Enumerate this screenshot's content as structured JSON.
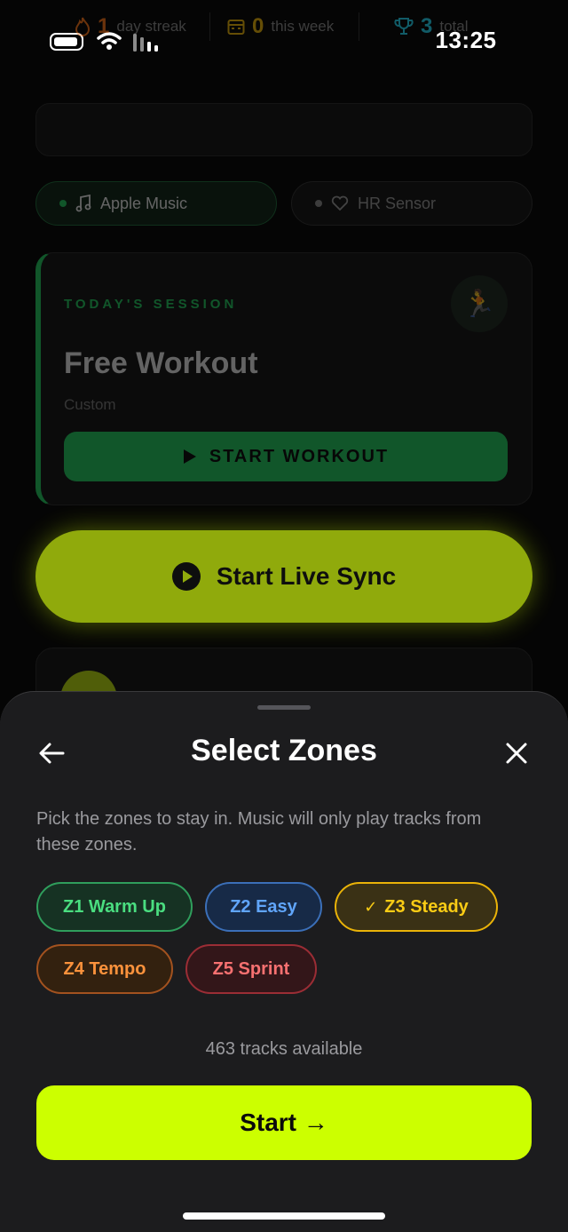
{
  "status_bar": {
    "time": "13:25"
  },
  "stats": {
    "streak": {
      "value": "1",
      "label": "day streak",
      "color": "#f97316"
    },
    "week": {
      "value": "0",
      "label": "this week",
      "color": "#eab308"
    },
    "total": {
      "value": "3",
      "label": "total",
      "color": "#22d3ee"
    }
  },
  "connections": {
    "music": {
      "label": "Apple Music",
      "dot_color": "#22c55e",
      "icon": "music-note-icon"
    },
    "hr": {
      "label": "HR Sensor",
      "dot_color": "#8a8a8a",
      "icon": "heart-icon"
    }
  },
  "session": {
    "kicker": "TODAY'S SESSION",
    "title": "Free Workout",
    "subtitle": "Custom",
    "badge_icon": "🏃",
    "start_label": "START WORKOUT"
  },
  "live_sync": {
    "label": "Start Live Sync"
  },
  "sheet": {
    "title": "Select Zones",
    "description": "Pick the zones to stay in. Music will only play tracks from these zones.",
    "zones": [
      {
        "label": "Z1 Warm Up",
        "selected": false
      },
      {
        "label": "Z2 Easy",
        "selected": false
      },
      {
        "label": "Z3 Steady",
        "selected": true,
        "check": "✓"
      },
      {
        "label": "Z4 Tempo",
        "selected": false
      },
      {
        "label": "Z5 Sprint",
        "selected": false
      }
    ],
    "tracks_available": "463 tracks available",
    "start_label": "Start →",
    "accent": "#ccff00"
  }
}
